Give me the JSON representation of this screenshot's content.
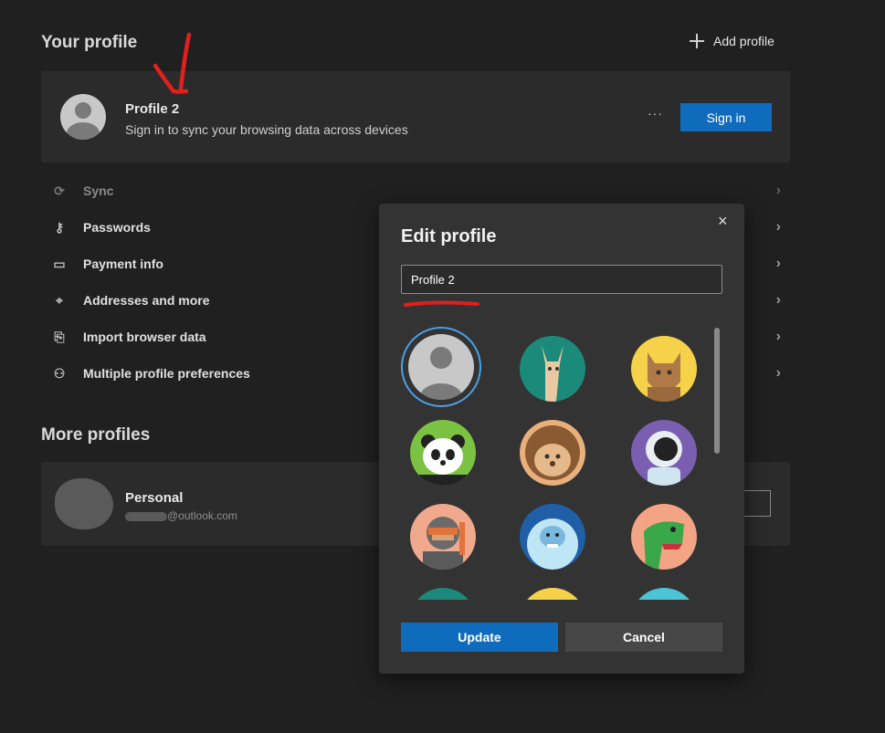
{
  "header": {
    "title": "Your profile",
    "add_profile_label": "Add profile"
  },
  "current_profile": {
    "name": "Profile 2",
    "subtitle": "Sign in to sync your browsing data across devices",
    "more_label": "···",
    "sign_in_label": "Sign in"
  },
  "menu": [
    {
      "label": "Sync",
      "icon": "sync-icon"
    },
    {
      "label": "Passwords",
      "icon": "key-icon"
    },
    {
      "label": "Payment info",
      "icon": "card-icon"
    },
    {
      "label": "Addresses and more",
      "icon": "location-pin-icon"
    },
    {
      "label": "Import browser data",
      "icon": "import-icon"
    },
    {
      "label": "Multiple profile preferences",
      "icon": "people-icon"
    }
  ],
  "more_profiles": {
    "title": "More profiles",
    "items": [
      {
        "name": "Personal",
        "email": "@outlook.com"
      }
    ]
  },
  "dialog": {
    "title": "Edit profile",
    "name_value": "Profile 2",
    "close_label": "×",
    "update_label": "Update",
    "cancel_label": "Cancel",
    "avatars": [
      "default-avatar",
      "llama-avatar",
      "cat-avatar",
      "panda-avatar",
      "hedgehog-avatar",
      "astronaut-avatar",
      "ninja-avatar",
      "yeti-avatar",
      "dinosaur-avatar"
    ],
    "selected_avatar": "default-avatar"
  },
  "colors": {
    "accent": "#0f6cbd",
    "annotation": "#e0201f",
    "selection_ring": "#4aa0e6"
  }
}
